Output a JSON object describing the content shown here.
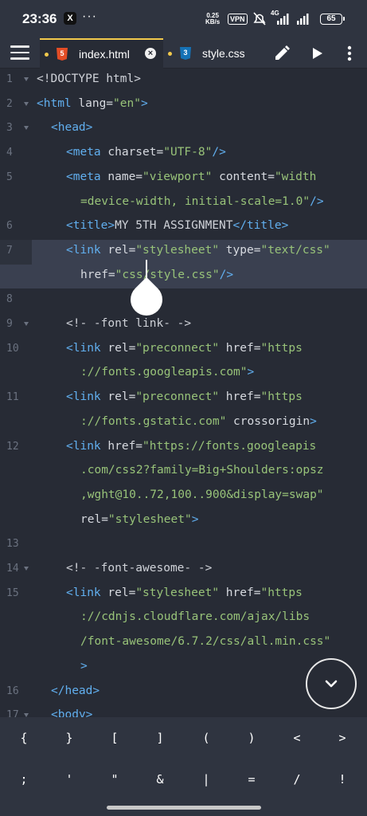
{
  "status_bar": {
    "time": "23:36",
    "notification_icon": "X",
    "more_dots": "···",
    "net_speed_value": "0.25",
    "net_speed_unit": "KB/s",
    "vpn": "VPN",
    "network": "4G",
    "battery": "65"
  },
  "toolbar": {
    "tabs": [
      {
        "label": "index.html",
        "icon": "html5-icon",
        "active": true
      },
      {
        "label": "style.css",
        "icon": "css3-icon",
        "active": false
      }
    ],
    "icons": [
      "menu-icon",
      "pencil-icon",
      "play-icon",
      "more-vert-icon"
    ]
  },
  "editor": {
    "active_line": 7,
    "lines": [
      {
        "n": "1",
        "fold": true
      },
      {
        "n": "2",
        "fold": true
      },
      {
        "n": "3",
        "fold": true
      },
      {
        "n": "4",
        "fold": false
      },
      {
        "n": "5",
        "fold": false
      },
      {
        "n": "6",
        "fold": false
      },
      {
        "n": "7",
        "fold": false
      },
      {
        "n": "8",
        "fold": false
      },
      {
        "n": "9",
        "fold": true
      },
      {
        "n": "10",
        "fold": false
      },
      {
        "n": "11",
        "fold": false
      },
      {
        "n": "12",
        "fold": false
      },
      {
        "n": "13",
        "fold": false
      },
      {
        "n": "14",
        "fold": true
      },
      {
        "n": "15",
        "fold": false
      },
      {
        "n": "16",
        "fold": false
      },
      {
        "n": "17",
        "fold": true
      }
    ],
    "code": {
      "l1": "<!DOCTYPE html>",
      "l2_tag": "<html",
      "l2_attr": " lang=",
      "l2_val": "\"en\"",
      "l2_end": ">",
      "l3": "<head>",
      "l4_tag": "<meta",
      "l4_attr": " charset=",
      "l4_val": "\"UTF-8\"",
      "l4_end": "/>",
      "l5_tag": "<meta",
      "l5_attr1": " name=",
      "l5_val1": "\"viewport\"",
      "l5_attr2": " content=",
      "l5_val2a": "\"width",
      "l5_val2b": "=device-width, initial-scale=1.0\"",
      "l5_end": "/>",
      "l6_tag": "<title>",
      "l6_text": "MY 5TH ASSIGNMENT",
      "l6_close": "</title>",
      "l7_tag": "<link",
      "l7_attr1": " rel=",
      "l7_val1": "\"stylesheet\"",
      "l7_attr2": " type=",
      "l7_val2": "\"text/css\"",
      "l7b_attr": "href=",
      "l7b_val": "\"css/style.css\"",
      "l7b_end": "/>",
      "l9": "<!- -font link- ->",
      "l10_tag": "<link",
      "l10_attr1": " rel=",
      "l10_val1": "\"preconnect\"",
      "l10_attr2": " href=",
      "l10_val2a": "\"https",
      "l10_val2b": "://fonts.googleapis.com\"",
      "l10_end": ">",
      "l11_tag": "<link",
      "l11_attr1": " rel=",
      "l11_val1": "\"preconnect\"",
      "l11_attr2": " href=",
      "l11_val2a": "\"https",
      "l11_val2b": "://fonts.gstatic.com\"",
      "l11_attr3": " crossorigin",
      "l11_end": ">",
      "l12_tag": "<link",
      "l12_attr1": " href=",
      "l12_val1a": "\"https://fonts.googleapis",
      "l12_val1b": ".com/css2?family=Big+Shoulders:opsz",
      "l12_val1c": ",wght@10..72,100..900&display=swap\"",
      "l12_attr2": "rel=",
      "l12_val2": "\"stylesheet\"",
      "l12_end": ">",
      "l14": "<!- -font-awesome- ->",
      "l15_tag": "<link",
      "l15_attr1": " rel=",
      "l15_val1": "\"stylesheet\"",
      "l15_attr2": " href=",
      "l15_val2a": "\"https",
      "l15_val2b": "://cdnjs.cloudflare.com/ajax/libs",
      "l15_val2c": "/font-awesome/6.7.2/css/all.min.css\"",
      "l15_end": ">",
      "l16": "</head>",
      "l17": "<body>"
    }
  },
  "symbol_bar": {
    "row1": [
      "{",
      "}",
      "[",
      "]",
      "(",
      ")",
      "<",
      ">"
    ],
    "row2": [
      ";",
      "'",
      "\"",
      "&",
      "|",
      "=",
      "/",
      "!"
    ]
  },
  "colors": {
    "background": "#272b35",
    "toolbar": "#2f3440",
    "active_line": "#3a4050",
    "tag": "#61afef",
    "string": "#98c379",
    "active_tab_accent": "#f2c94c"
  }
}
